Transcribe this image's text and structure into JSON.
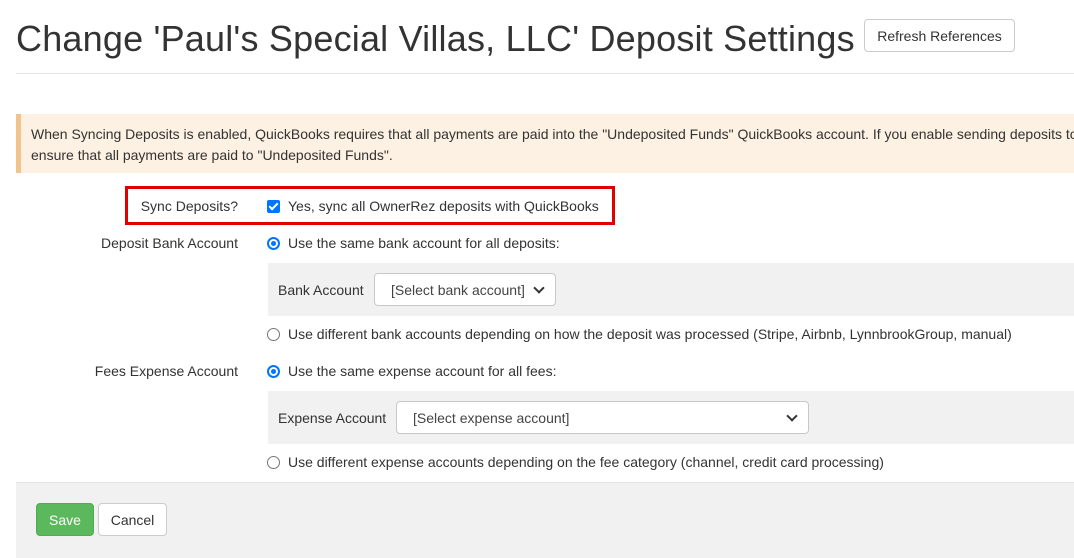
{
  "header": {
    "title": "Change 'Paul's Special Villas, LLC' Deposit Settings",
    "refresh_label": "Refresh References"
  },
  "alert": {
    "line1": "When Syncing Deposits is enabled, QuickBooks requires that all payments are paid into the \"Undeposited Funds\" QuickBooks account. If you enable sending deposits to",
    "line2": "ensure that all payments are paid to \"Undeposited Funds\"."
  },
  "sync": {
    "label": "Sync Deposits?",
    "checkbox_label": "Yes, sync all OwnerRez deposits with QuickBooks",
    "checked": true
  },
  "deposit_bank": {
    "label": "Deposit Bank Account",
    "option_same": "Use the same bank account for all deposits:",
    "sub_label": "Bank Account",
    "select_value": "[Select bank account]",
    "option_different": "Use different bank accounts depending on how the deposit was processed (Stripe, Airbnb, LynnbrookGroup, manual)",
    "selected": "same"
  },
  "fees_expense": {
    "label": "Fees Expense Account",
    "option_same": "Use the same expense account for all fees:",
    "sub_label": "Expense Account",
    "select_value": "[Select expense account]",
    "option_different": "Use different expense accounts depending on the fee category (channel, credit card processing)",
    "selected": "same"
  },
  "footer": {
    "save_label": "Save",
    "cancel_label": "Cancel"
  },
  "colors": {
    "alert_bg": "#fcf1e2",
    "alert_border": "#f2c48d",
    "highlight": "#e00000",
    "save": "#5cb85c",
    "control_accent": "#0075ff"
  }
}
